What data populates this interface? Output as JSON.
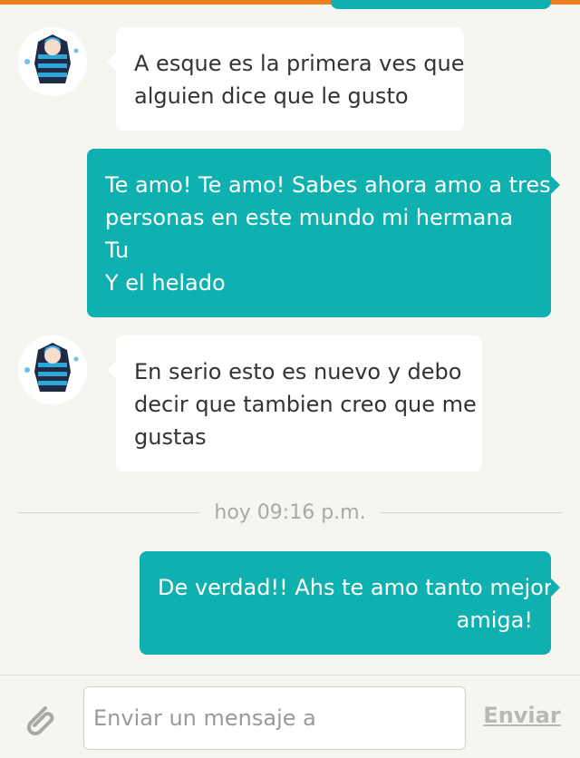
{
  "colors": {
    "accent": "#f07d22",
    "outgoing_bubble": "#0fb1b0",
    "incoming_bubble": "#ffffff",
    "background": "#f7f5f0"
  },
  "messages": [
    {
      "direction": "incoming",
      "lines": [
        "A esque es la primera ves que",
        "alguien dice que le gusto"
      ]
    },
    {
      "direction": "outgoing",
      "lines": [
        "Te amo! Te amo! Sabes ahora amo a tres",
        "personas en este mundo mi hermana",
        "Tu",
        "Y el helado"
      ]
    },
    {
      "direction": "incoming",
      "lines": [
        "En serio esto es nuevo y debo",
        "decir que tambien creo que me",
        "gustas"
      ]
    },
    {
      "direction": "outgoing",
      "lines": [
        "De verdad!! Ahs te amo tanto mejor",
        "amiga!"
      ]
    }
  ],
  "timestamp_separator": "hoy 09:16 p.m.",
  "composer": {
    "attach_icon": "paperclip-icon",
    "placeholder": "Enviar un mensaje a",
    "value": "",
    "send_label": "Enviar"
  }
}
